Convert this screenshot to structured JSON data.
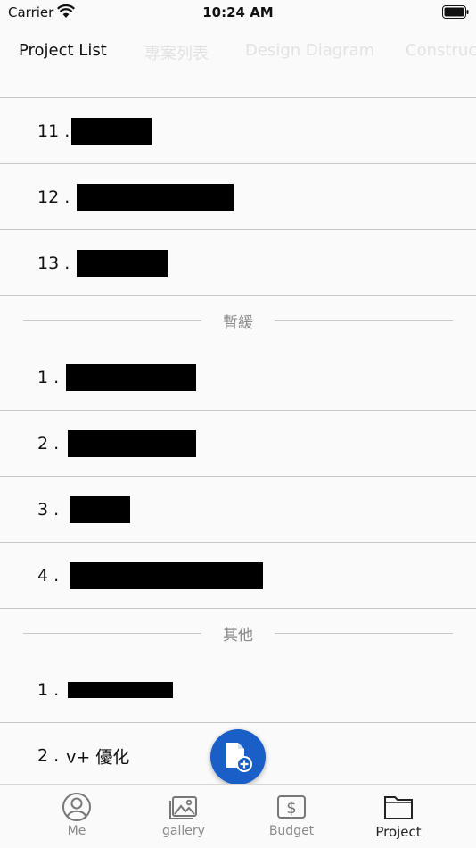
{
  "status_bar": {
    "carrier": "Carrier",
    "time": "10:24 AM"
  },
  "tabs": [
    {
      "label": "Project List",
      "active": true
    },
    {
      "label": "專案列表",
      "active": false
    },
    {
      "label": "Design Diagram",
      "active": false
    },
    {
      "label": "Construc",
      "active": false
    }
  ],
  "sections": {
    "top_rows": [
      {
        "prefix": "11 ."
      },
      {
        "prefix": "12 ."
      },
      {
        "prefix": "13 ."
      }
    ],
    "paused": {
      "header": "暫緩",
      "rows": [
        {
          "prefix": "1 ."
        },
        {
          "prefix": "2 ."
        },
        {
          "prefix": "3 ."
        },
        {
          "prefix": "4 ."
        }
      ]
    },
    "other": {
      "header": "其他",
      "rows": [
        {
          "prefix": "1 ."
        },
        {
          "prefix": "2 .",
          "text": "v+ 優化"
        }
      ]
    }
  },
  "fab": {
    "icon": "file-add-icon"
  },
  "bottom_nav": [
    {
      "label": "Me",
      "icon": "person-circle-icon",
      "active": false
    },
    {
      "label": "gallery",
      "icon": "image-icon",
      "active": false
    },
    {
      "label": "Budget",
      "icon": "dollar-icon",
      "active": false
    },
    {
      "label": "Project",
      "icon": "folder-icon",
      "active": true
    }
  ],
  "colors": {
    "accent": "#1a5ec8",
    "divider": "#c8c8c8",
    "inactive_tab": "#e2e2e2",
    "muted": "#8a8a8a"
  }
}
